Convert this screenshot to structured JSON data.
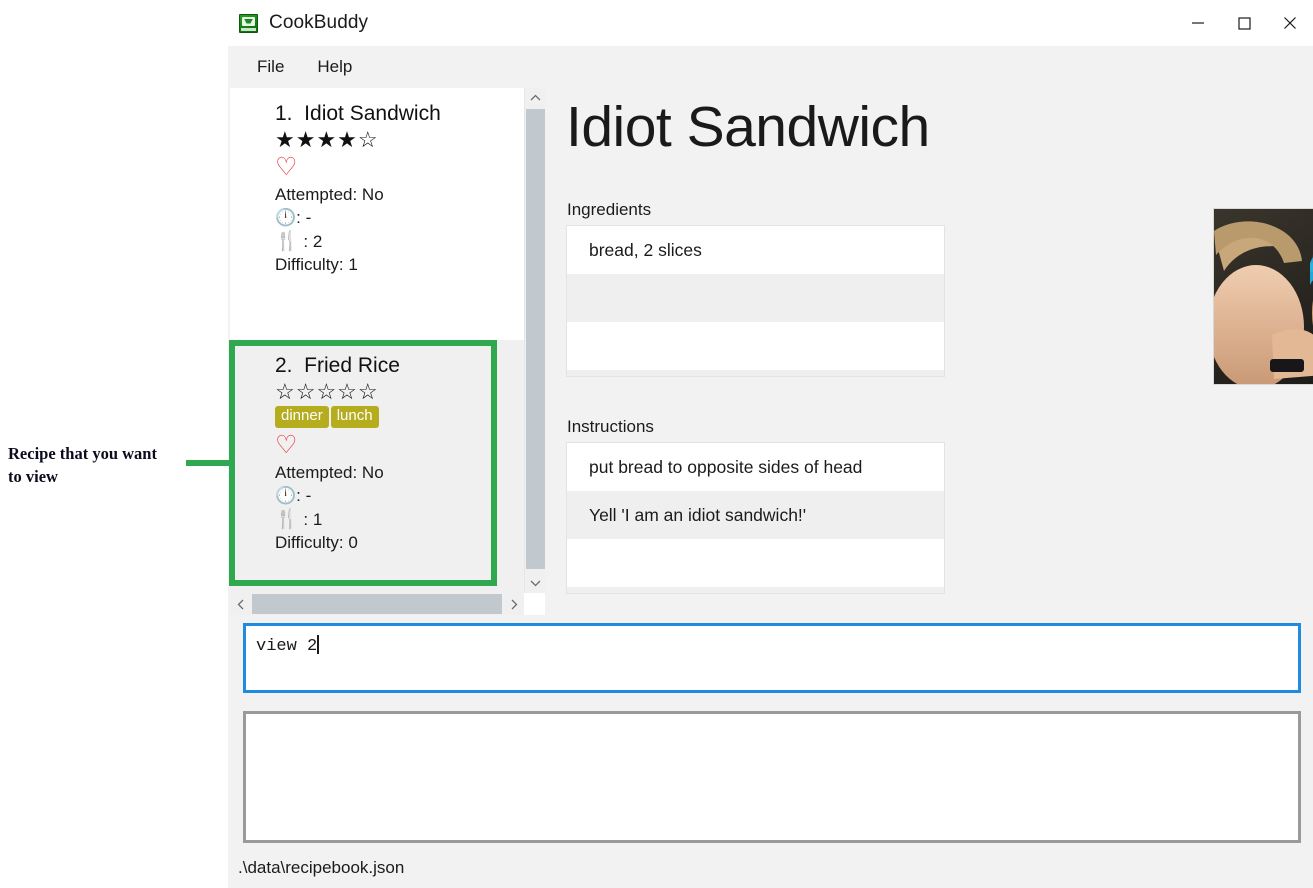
{
  "window": {
    "title": "CookBuddy",
    "icon": "cookbook-icon",
    "controls": [
      {
        "name": "minimize-button",
        "glyph": "minimize-icon"
      },
      {
        "name": "maximize-button",
        "glyph": "maximize-icon"
      },
      {
        "name": "close-button",
        "glyph": "close-icon"
      }
    ]
  },
  "menu": {
    "items": [
      {
        "label": "File"
      },
      {
        "label": "Help"
      }
    ]
  },
  "recipe_list": {
    "scrollbar": {
      "up_arrow_icon": "chevron-up-icon",
      "down_arrow_icon": "chevron-down-icon",
      "left_arrow_icon": "chevron-left-icon",
      "right_arrow_icon": "chevron-right-icon"
    },
    "items": [
      {
        "index": "1.",
        "title": "Idiot Sandwich",
        "heading": "1.  Idiot Sandwich",
        "rating": 4,
        "rating_max": 5,
        "stars": "★★★★☆",
        "tags": [],
        "favorite": false,
        "favorite_icon": "heart-outline-icon",
        "attempted_label": "Attempted: No",
        "time_icon": "clock-icon",
        "time_value": "-",
        "time_line": ": -",
        "servings_icon": "fork-knife-icon",
        "servings_value": "2",
        "servings_line": " : 2",
        "difficulty_label": "Difficulty: 1",
        "selected": false
      },
      {
        "index": "2.",
        "title": "Fried Rice",
        "heading": "2.  Fried Rice",
        "rating": 0,
        "rating_max": 5,
        "stars": "☆☆☆☆☆",
        "tags": [
          "dinner",
          "lunch"
        ],
        "favorite": false,
        "favorite_icon": "heart-outline-icon",
        "attempted_label": "Attempted: No",
        "time_icon": "clock-icon",
        "time_value": "-",
        "time_line": ": -",
        "servings_icon": "fork-knife-icon",
        "servings_value": "1",
        "servings_line": " : 1",
        "difficulty_label": "Difficulty: 0",
        "selected": true
      }
    ]
  },
  "detail": {
    "title": "Idiot Sandwich",
    "ingredients_label": "Ingredients",
    "ingredients": [
      "bread, 2 slices",
      "",
      "",
      ""
    ],
    "instructions_label": "Instructions",
    "instructions": [
      "put bread to opposite sides of head",
      "Yell 'I am an idiot sandwich!'",
      "",
      ""
    ],
    "photo_alt": "recipe-photo"
  },
  "command": {
    "value": "view 2",
    "placeholder": ""
  },
  "output": {
    "value": ""
  },
  "status": {
    "path": ".\\data\\recipebook.json"
  },
  "annotation": {
    "text": "Recipe that you want\nto view",
    "color": "#2fa84f"
  },
  "colors": {
    "accent_green": "#2fa84f",
    "tag_olive": "#b5ad1e",
    "heart_red": "#ef2b3c",
    "input_focus_blue": "#1f8ce0",
    "window_bg": "#f2f2f2"
  }
}
